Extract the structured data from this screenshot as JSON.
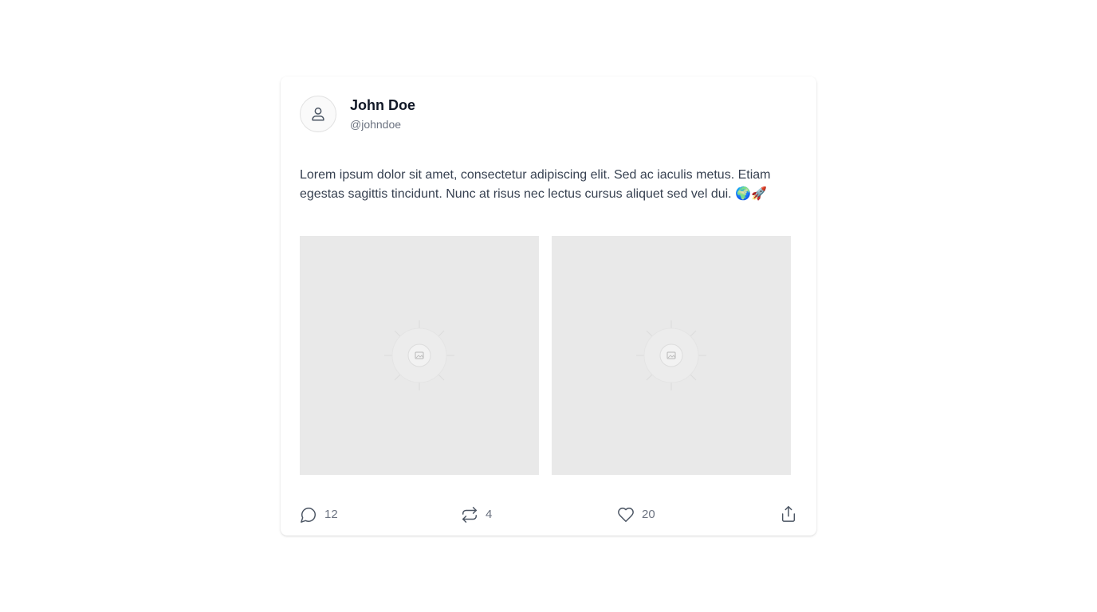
{
  "post": {
    "author": {
      "name": "John Doe",
      "handle": "@johndoe",
      "avatar_icon": "user-icon"
    },
    "text": "Lorem ipsum dolor sit amet, consectetur adipiscing elit. Sed ac iaculis metus. Etiam egestas sagittis tincidunt. Nunc at risus nec lectus cursus aliquet sed vel dui. 🌍🚀",
    "images": [
      {
        "icon": "image-icon"
      },
      {
        "icon": "image-icon"
      }
    ],
    "actions": {
      "comments": {
        "icon": "comment-icon",
        "count": "12"
      },
      "reposts": {
        "icon": "repost-icon",
        "count": "4"
      },
      "likes": {
        "icon": "heart-icon",
        "count": "20"
      },
      "share": {
        "icon": "share-icon"
      }
    }
  },
  "colors": {
    "name": "#111827",
    "handle": "#6b7280",
    "body_text": "#374151",
    "image_placeholder": "#e9e9e9",
    "icon": "#4b5563"
  }
}
